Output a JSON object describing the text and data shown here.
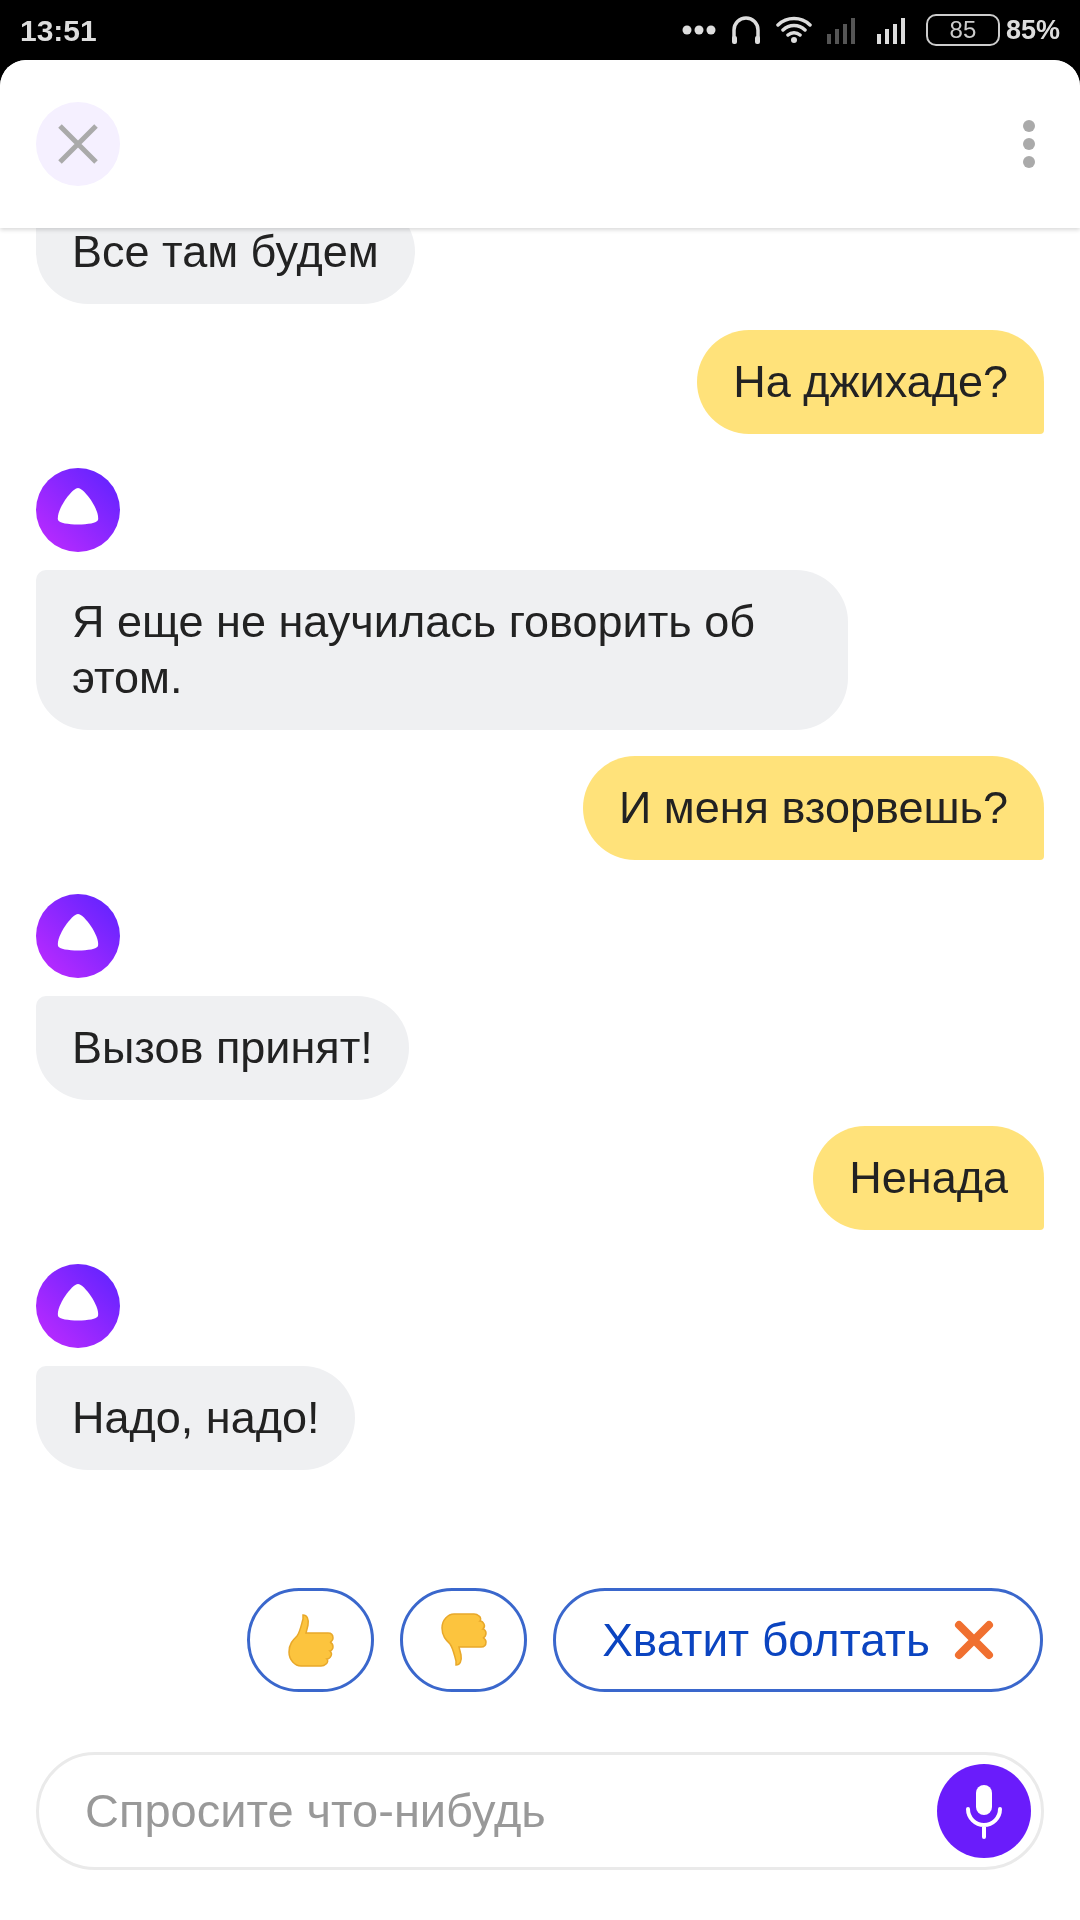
{
  "status_bar": {
    "time": "13:51",
    "battery_level": "85",
    "battery_percent": "85%"
  },
  "messages": [
    {
      "kind": "assistant",
      "avatar": false,
      "text": "Все там будем"
    },
    {
      "kind": "user",
      "text": "На джихаде?"
    },
    {
      "kind": "assistant",
      "avatar": true,
      "text": "Я еще не научилась говорить об этом."
    },
    {
      "kind": "user",
      "text": "И меня взорвешь?"
    },
    {
      "kind": "assistant",
      "avatar": true,
      "text": "Вызов принят!"
    },
    {
      "kind": "user",
      "text": "Ненада"
    },
    {
      "kind": "assistant",
      "avatar": true,
      "text": "Надо, надо!"
    }
  ],
  "quick_replies": [
    {
      "kind": "like"
    },
    {
      "kind": "dislike"
    },
    {
      "kind": "stop",
      "label": "Хватит болтать"
    }
  ],
  "input": {
    "placeholder": "Спросите что-нибудь"
  }
}
